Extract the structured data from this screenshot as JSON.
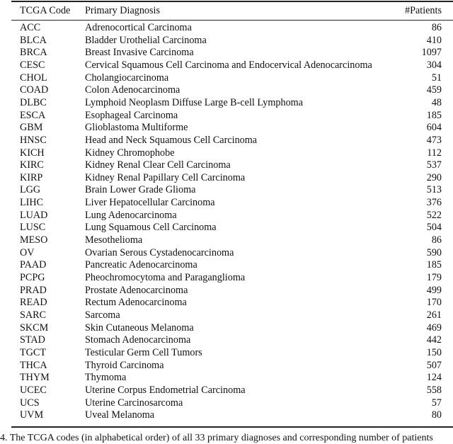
{
  "table": {
    "headers": [
      "TCGA Code",
      "Primary Diagnosis",
      "#Patients"
    ],
    "rows": [
      [
        "ACC",
        "Adrenocortical Carcinoma",
        "86"
      ],
      [
        "BLCA",
        "Bladder Urothelial Carcinoma",
        "410"
      ],
      [
        "BRCA",
        "Breast Invasive Carcinoma",
        "1097"
      ],
      [
        "CESC",
        "Cervical Squamous Cell Carcinoma and Endocervical Adenocarcinoma",
        "304"
      ],
      [
        "CHOL",
        "Cholangiocarcinoma",
        "51"
      ],
      [
        "COAD",
        "Colon Adenocarcinoma",
        "459"
      ],
      [
        "DLBC",
        "Lymphoid Neoplasm Diffuse Large B-cell Lymphoma",
        "48"
      ],
      [
        "ESCA",
        "Esophageal Carcinoma",
        "185"
      ],
      [
        "GBM",
        "Glioblastoma Multiforme",
        "604"
      ],
      [
        "HNSC",
        "Head and Neck Squamous Cell Carcinoma",
        "473"
      ],
      [
        "KICH",
        "Kidney Chromophobe",
        "112"
      ],
      [
        "KIRC",
        "Kidney Renal Clear Cell Carcinoma",
        "537"
      ],
      [
        "KIRP",
        "Kidney Renal Papillary Cell Carcinoma",
        "290"
      ],
      [
        "LGG",
        "Brain Lower Grade Glioma",
        "513"
      ],
      [
        "LIHC",
        "Liver Hepatocellular Carcinoma",
        "376"
      ],
      [
        "LUAD",
        "Lung Adenocarcinoma",
        "522"
      ],
      [
        "LUSC",
        "Lung Squamous Cell Carcinoma",
        "504"
      ],
      [
        "MESO",
        "Mesothelioma",
        "86"
      ],
      [
        "OV",
        "Ovarian Serous Cystadenocarcinoma",
        "590"
      ],
      [
        "PAAD",
        "Pancreatic Adenocarcinoma",
        "185"
      ],
      [
        "PCPG",
        "Pheochromocytoma and Paraganglioma",
        "179"
      ],
      [
        "PRAD",
        "Prostate Adenocarcinoma",
        "499"
      ],
      [
        "READ",
        "Rectum Adenocarcinoma",
        "170"
      ],
      [
        "SARC",
        "Sarcoma",
        "261"
      ],
      [
        "SKCM",
        "Skin Cutaneous Melanoma",
        "469"
      ],
      [
        "STAD",
        "Stomach Adenocarcinoma",
        "442"
      ],
      [
        "TGCT",
        "Testicular Germ Cell Tumors",
        "150"
      ],
      [
        "THCA",
        "Thyroid Carcinoma",
        "507"
      ],
      [
        "THYM",
        "Thymoma",
        "124"
      ],
      [
        "UCEC",
        "Uterine Corpus Endometrial Carcinoma",
        "558"
      ],
      [
        "UCS",
        "Uterine Carcinosarcoma",
        "57"
      ],
      [
        "UVM",
        "Uveal Melanoma",
        "80"
      ]
    ]
  },
  "caption": "4. The TCGA codes (in alphabetical order) of all 33 primary diagnoses and corresponding number of patients"
}
